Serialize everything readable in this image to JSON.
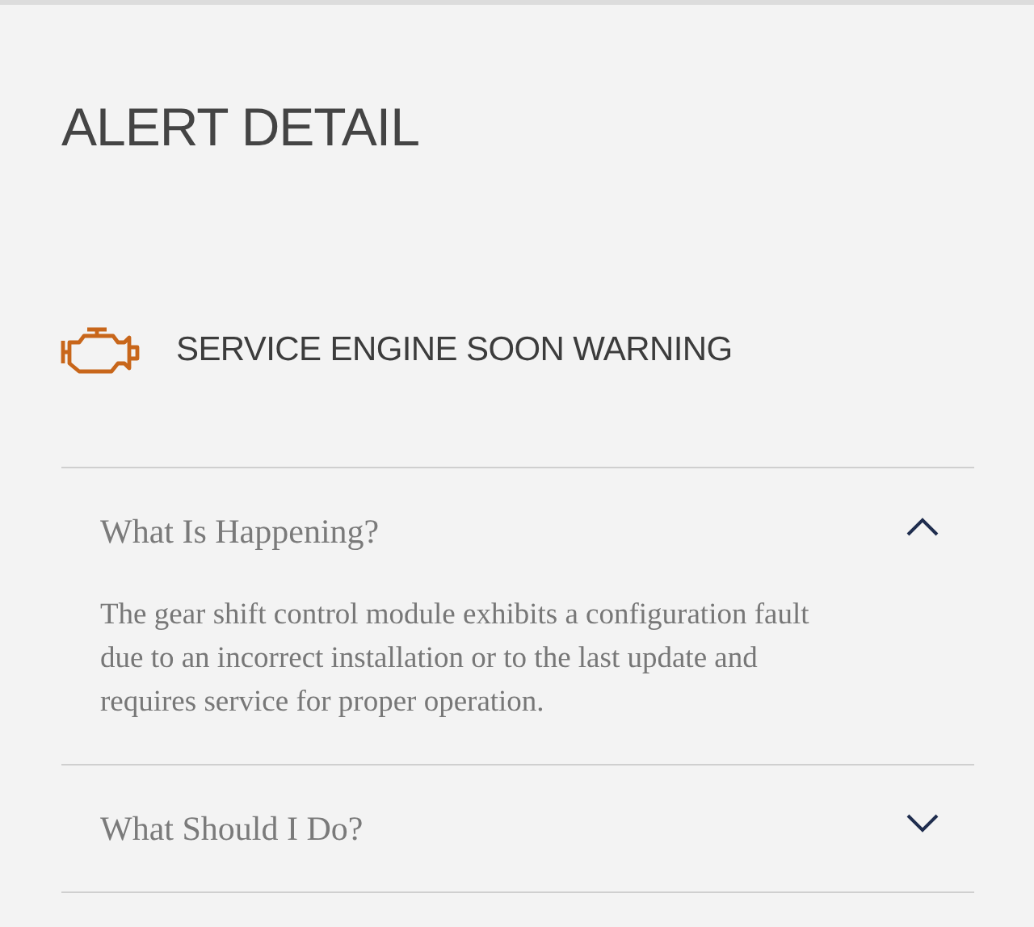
{
  "title": "ALERT DETAIL",
  "alert": {
    "label": "SERVICE ENGINE SOON WARNING"
  },
  "sections": [
    {
      "title": "What Is Happening?",
      "expanded": true,
      "body": "The gear shift control module exhibits a configuration fault due to an incorrect installation or to the last update and requires service for proper operation."
    },
    {
      "title": "What Should I Do?",
      "expanded": false
    }
  ]
}
